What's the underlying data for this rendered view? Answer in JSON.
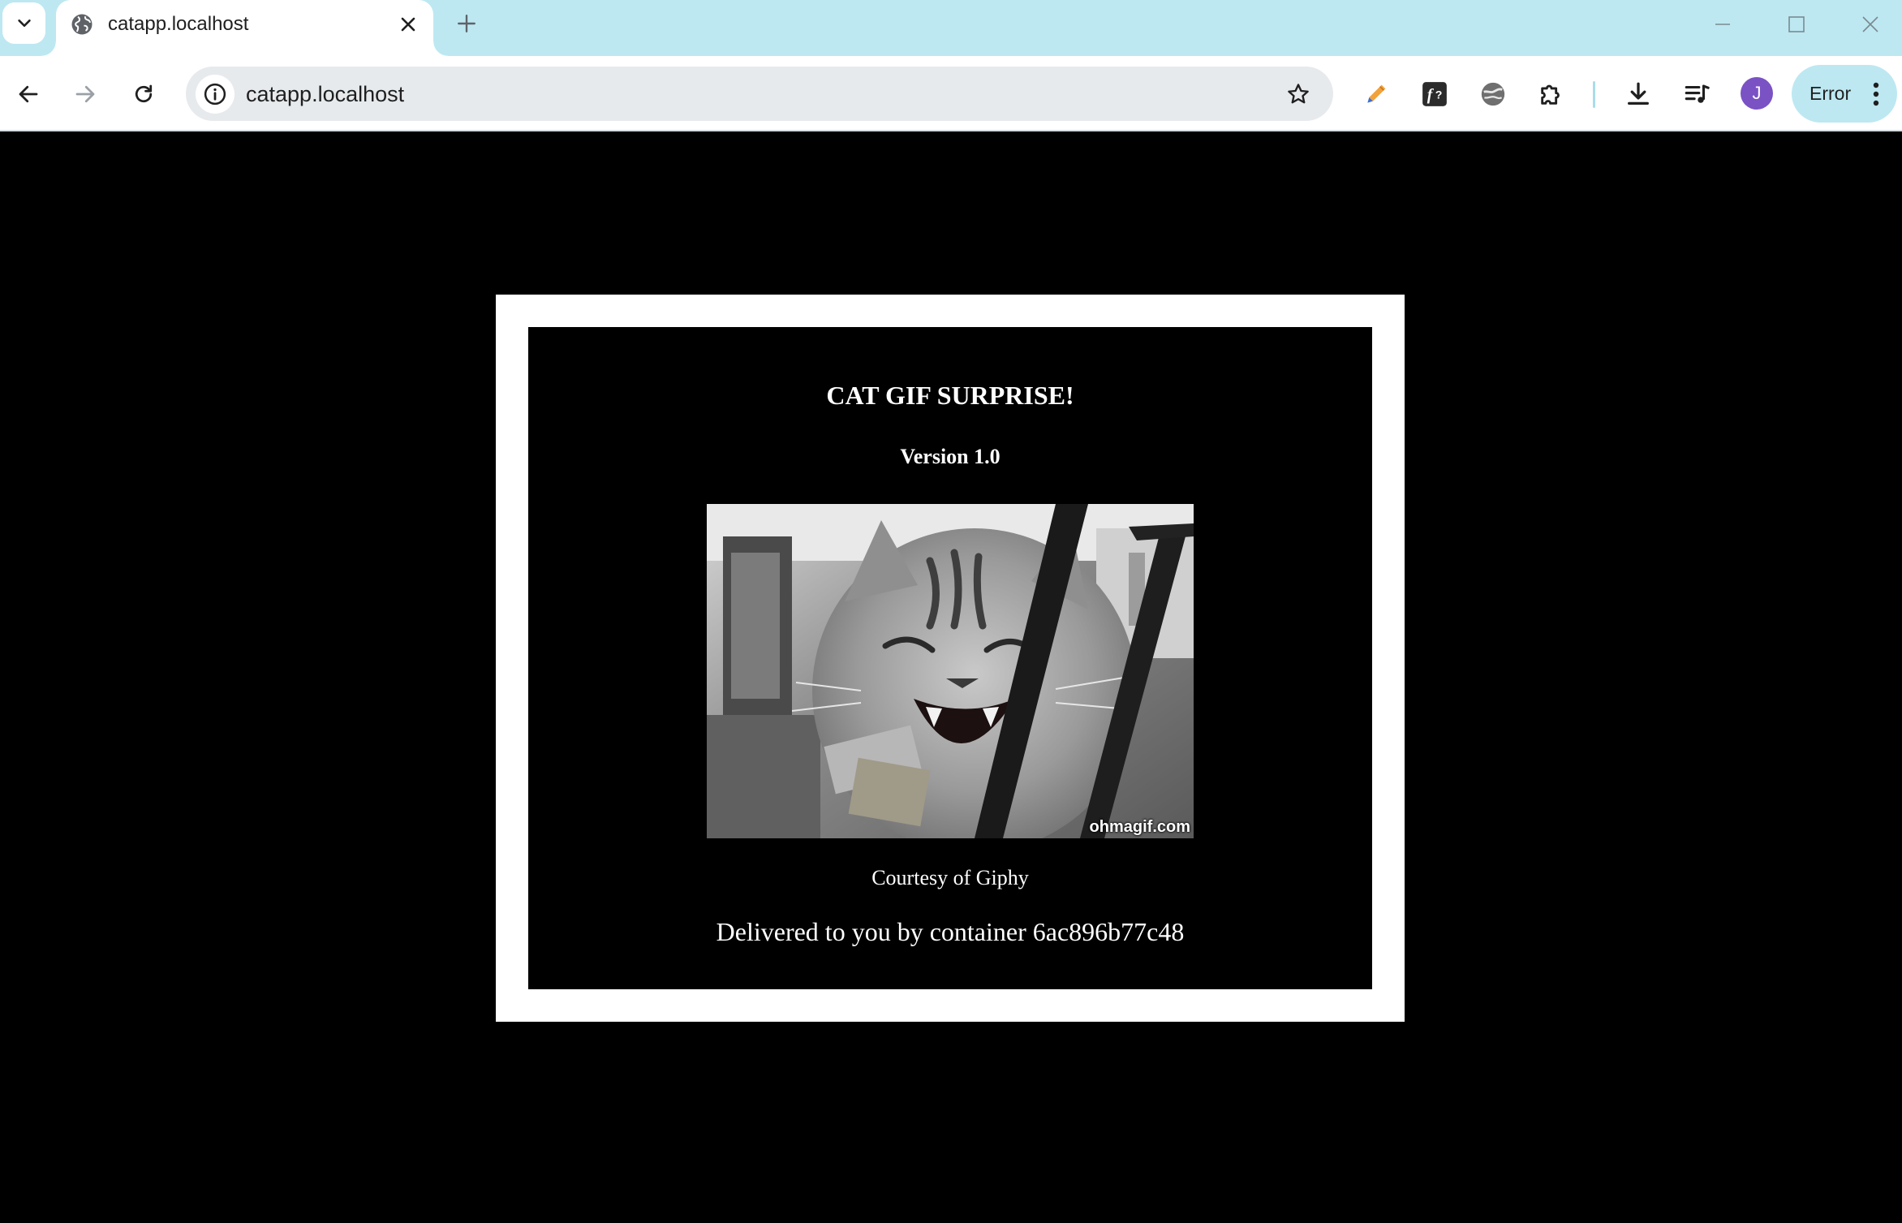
{
  "browser": {
    "tab": {
      "title": "catapp.localhost",
      "favicon": "globe-icon"
    },
    "address_bar": {
      "url": "catapp.localhost"
    },
    "profile": {
      "initial": "J",
      "color": "#7a52c4"
    },
    "status_chip": {
      "label": "Error"
    },
    "colors": {
      "tabstrip": "#bde8f2",
      "omnibox": "#e7eaed"
    },
    "extension_icons": [
      "pen-icon",
      "function-icon",
      "globe-icon",
      "puzzle-icon"
    ],
    "toolbar_icons": [
      "download-icon",
      "media-queue-icon"
    ]
  },
  "page": {
    "title": "CAT GIF SURPRISE!",
    "version": "Version 1.0",
    "image_watermark": "ohmagif.com",
    "courtesy": "Courtesy of Giphy",
    "delivered": "Delivered to you by container 6ac896b77c48",
    "colors": {
      "background": "#000000",
      "frame": "#ffffff",
      "text": "#ffffff"
    }
  }
}
